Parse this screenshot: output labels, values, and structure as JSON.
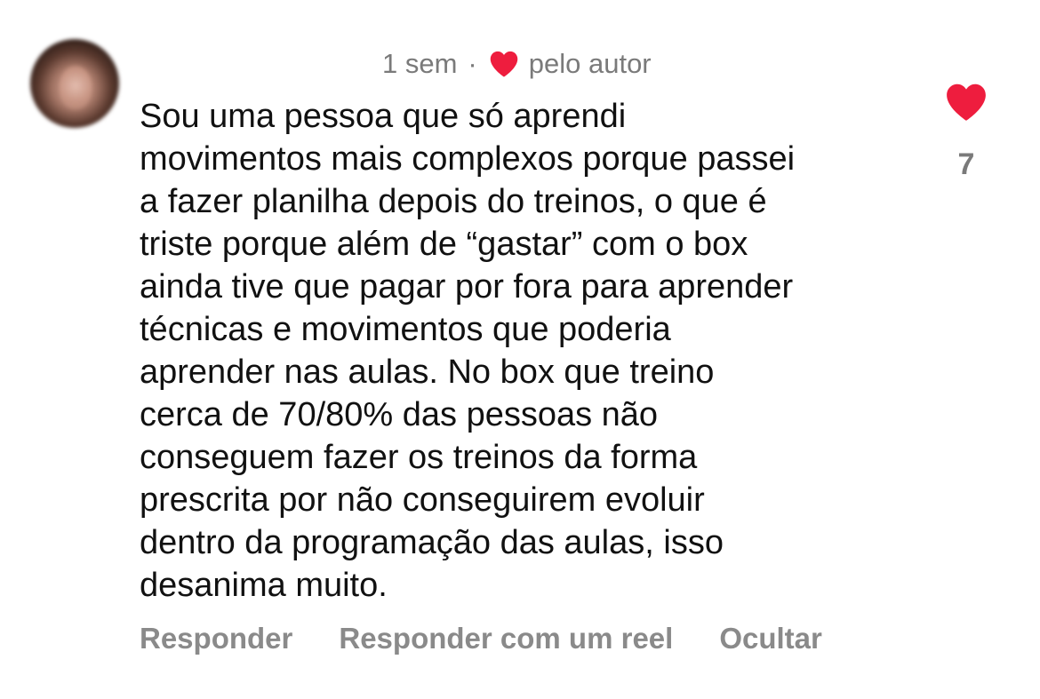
{
  "comment": {
    "author_avatar_icon": "avatar-blurred",
    "time": "1 sem",
    "separator": "·",
    "liked_by_author_label": "pelo autor",
    "liked_by_author_icon": "heart-icon",
    "text": "Sou uma pessoa que só aprendi\nmovimentos mais complexos porque passei\na fazer planilha depois do treinos, o que é\ntriste porque além de “gastar” com o box\nainda tive que pagar por fora para aprender\ntécnicas e movimentos que poderia\naprender nas aulas. No box que treino\ncerca de 70/80% das pessoas não\nconseguem fazer os treinos da forma\nprescrita por não conseguirem evoluir\ndentro da programação das aulas, isso\ndesanima muito.",
    "like_icon": "heart-icon",
    "like_count": "7",
    "heart_color": "#ee1d3e"
  },
  "actions": {
    "reply_label": "Responder",
    "reply_reel_label": "Responder com um reel",
    "hide_label": "Ocultar"
  }
}
